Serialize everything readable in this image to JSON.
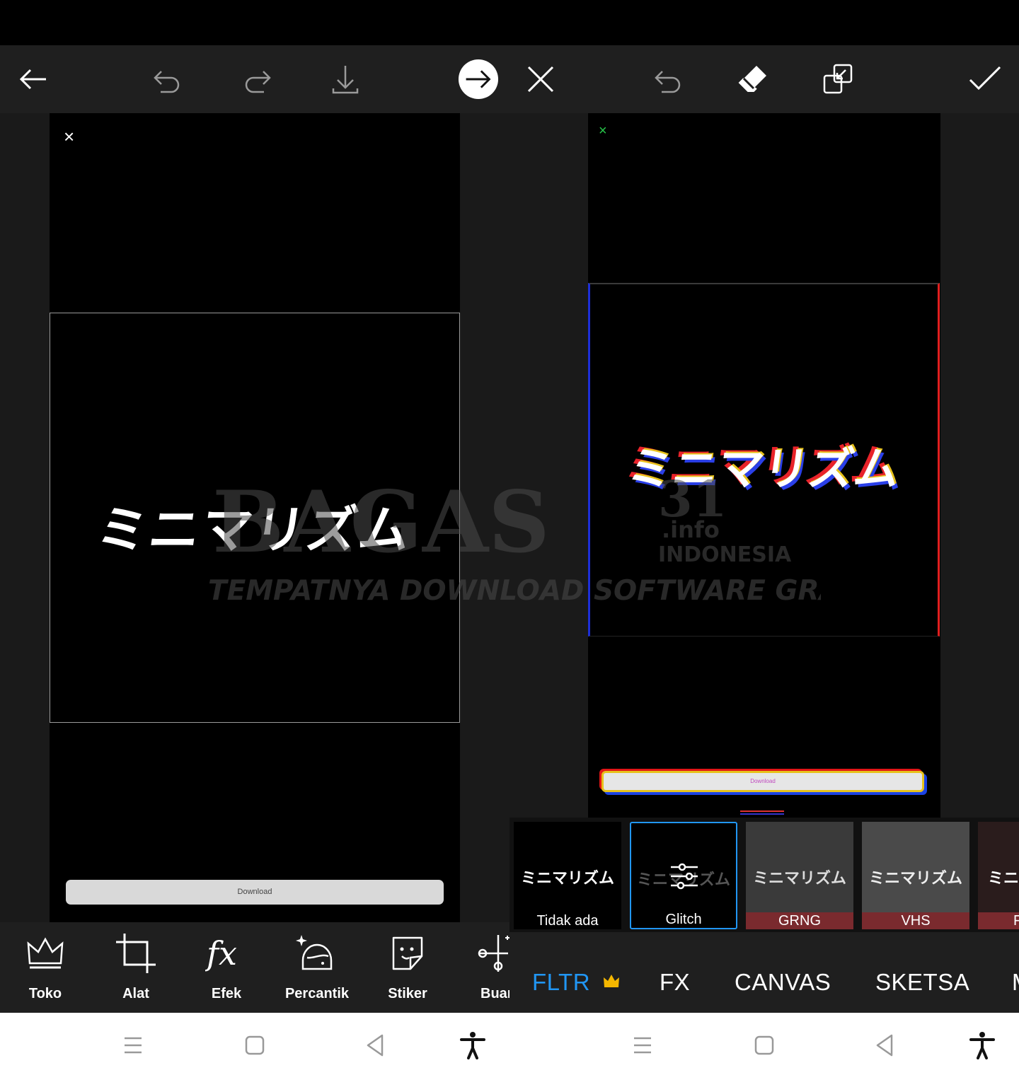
{
  "left_toolbar": {
    "back": "back-arrow-icon",
    "undo": "undo-icon",
    "redo": "redo-icon",
    "save": "download-icon",
    "next": "forward-arrow-icon"
  },
  "right_toolbar": {
    "close": "close-icon",
    "undo": "undo-icon",
    "eraser": "eraser-icon",
    "compare": "layers-icon",
    "apply": "checkmark-icon"
  },
  "left_canvas": {
    "title": "ミニマリズム",
    "close_glyph": "×",
    "download_label": "Download"
  },
  "right_canvas": {
    "title": "ミニマリズム",
    "close_glyph": "×",
    "download_label": "Download"
  },
  "tools": [
    {
      "label": "Toko",
      "icon": "crown-icon"
    },
    {
      "label": "Alat",
      "icon": "crop-icon"
    },
    {
      "label": "Efek",
      "icon": "fx-icon"
    },
    {
      "label": "Percantik",
      "icon": "face-icon"
    },
    {
      "label": "Stiker",
      "icon": "sticker-icon"
    },
    {
      "label": "Buan",
      "icon": "brush-icon"
    }
  ],
  "filters": [
    {
      "label": "Tidak ada",
      "preview": "ミニマリズム",
      "selected": false
    },
    {
      "label": "Glitch",
      "preview": "ミニマリズム",
      "selected": true
    },
    {
      "label": "GRNG",
      "preview": "ミニマリズム",
      "selected": false
    },
    {
      "label": "VHS",
      "preview": "ミニマリズム",
      "selected": false
    },
    {
      "label": "F",
      "preview": "ミニ",
      "selected": false
    }
  ],
  "categories": [
    {
      "label": "FLTR",
      "active": true,
      "premium": true
    },
    {
      "label": "FX",
      "active": false
    },
    {
      "label": "CANVAS",
      "active": false
    },
    {
      "label": "SKETSA",
      "active": false
    },
    {
      "label": "M",
      "active": false
    }
  ],
  "watermark": {
    "brand": "BAGAS",
    "number": "31",
    "domain": ".info",
    "country": "INDONESIA",
    "tagline": "TEMPATNYA DOWNLOAD SOFTWARE GRATIS"
  },
  "colors": {
    "accent_blue": "#2196f3",
    "crown_gold": "#f5b700",
    "glitch_red": "#e01e1e",
    "glitch_blue": "#1d2fd8",
    "glitch_yellow": "#e7c21b"
  }
}
